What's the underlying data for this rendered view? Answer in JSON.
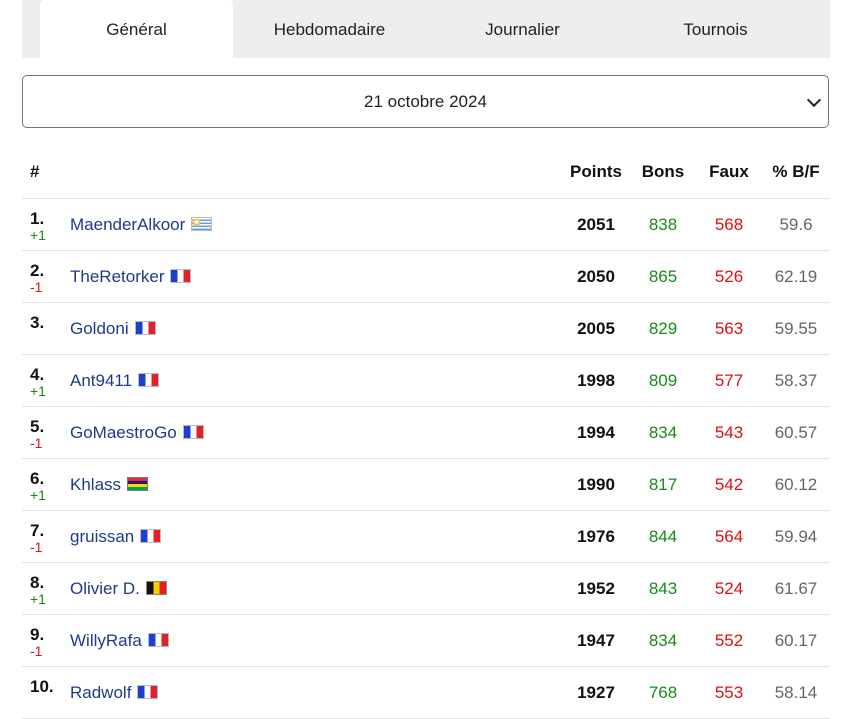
{
  "tabs": [
    "Général",
    "Hebdomadaire",
    "Journalier",
    "Tournois"
  ],
  "date_select": {
    "selected": "21 octobre 2024"
  },
  "table": {
    "headers": {
      "rank": "#",
      "points": "Points",
      "bons": "Bons",
      "faux": "Faux",
      "pct": "% B/F"
    },
    "rows": [
      {
        "rank": "1.",
        "delta": "+1",
        "name": "MaenderAlkoor",
        "flag": "uy",
        "points": "2051",
        "bons": "838",
        "faux": "568",
        "pct": "59.6"
      },
      {
        "rank": "2.",
        "delta": "-1",
        "name": "TheRetorker",
        "flag": "fr",
        "points": "2050",
        "bons": "865",
        "faux": "526",
        "pct": "62.19"
      },
      {
        "rank": "3.",
        "delta": "",
        "name": "Goldoni",
        "flag": "fr",
        "points": "2005",
        "bons": "829",
        "faux": "563",
        "pct": "59.55"
      },
      {
        "rank": "4.",
        "delta": "+1",
        "name": "Ant9411",
        "flag": "fr",
        "points": "1998",
        "bons": "809",
        "faux": "577",
        "pct": "58.37"
      },
      {
        "rank": "5.",
        "delta": "-1",
        "name": "GoMaestroGo",
        "flag": "fr",
        "points": "1994",
        "bons": "834",
        "faux": "543",
        "pct": "60.57"
      },
      {
        "rank": "6.",
        "delta": "+1",
        "name": "Khlass",
        "flag": "mu",
        "points": "1990",
        "bons": "817",
        "faux": "542",
        "pct": "60.12"
      },
      {
        "rank": "7.",
        "delta": "-1",
        "name": "gruissan",
        "flag": "fr",
        "points": "1976",
        "bons": "844",
        "faux": "564",
        "pct": "59.94"
      },
      {
        "rank": "8.",
        "delta": "+1",
        "name": "Olivier D.",
        "flag": "be",
        "points": "1952",
        "bons": "843",
        "faux": "524",
        "pct": "61.67"
      },
      {
        "rank": "9.",
        "delta": "-1",
        "name": "WillyRafa",
        "flag": "fr",
        "points": "1947",
        "bons": "834",
        "faux": "552",
        "pct": "60.17"
      },
      {
        "rank": "10.",
        "delta": "",
        "name": "Radwolf",
        "flag": "fr",
        "points": "1927",
        "bons": "768",
        "faux": "553",
        "pct": "58.14"
      }
    ]
  }
}
